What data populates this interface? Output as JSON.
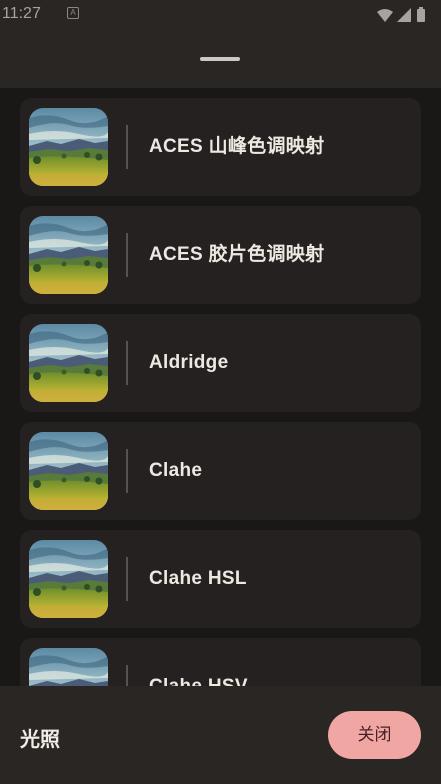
{
  "status_bar": {
    "time": "11:27",
    "notification_icon": "A"
  },
  "sheet": {
    "title": "光照",
    "close_label": "关闭"
  },
  "filters": [
    {
      "label": "ACES 山峰色调映射"
    },
    {
      "label": "ACES 胶片色调映射"
    },
    {
      "label": "Aldridge"
    },
    {
      "label": "Clahe"
    },
    {
      "label": "Clahe HSL"
    },
    {
      "label": "Clahe HSV"
    }
  ],
  "colors": {
    "accent": "#f0a6a2",
    "background": "#1a1817",
    "card": "#242120"
  }
}
